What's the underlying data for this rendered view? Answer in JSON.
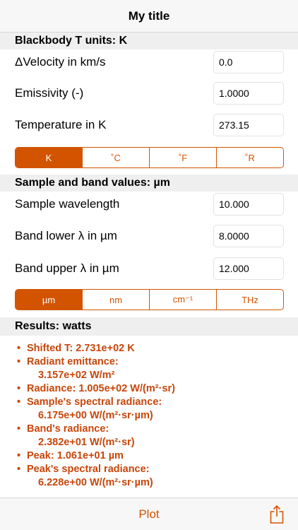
{
  "nav": {
    "title": "My title"
  },
  "sections": {
    "blackbody": "Blackbody T units: K",
    "sample": "Sample and band values: µm",
    "results": "Results: watts"
  },
  "fields": {
    "velocity": {
      "label": "ΔVelocity in km/s",
      "value": "0.0"
    },
    "emissivity": {
      "label": "Emissivity (-)",
      "value": "1.0000"
    },
    "temperature": {
      "label": "Temperature in K",
      "value": "273.15"
    },
    "sample_wavelength": {
      "label": "Sample wavelength",
      "value": "10.000"
    },
    "band_lower": {
      "label": "Band lower λ in µm",
      "value": "8.0000"
    },
    "band_upper": {
      "label": "Band upper λ in µm",
      "value": "12.000"
    }
  },
  "temp_units": {
    "selected": "K",
    "options": [
      "K",
      "˚C",
      "˚F",
      "˚R"
    ]
  },
  "wave_units": {
    "selected": "µm",
    "options": [
      "µm",
      "nm",
      "cm⁻¹",
      "THz"
    ]
  },
  "results": [
    {
      "line1": "Shifted T: 2.731e+02 K",
      "line2": ""
    },
    {
      "line1": "Radiant emittance:",
      "line2": "3.157e+02 W/m²"
    },
    {
      "line1": "Radiance: 1.005e+02 W/(m²·sr)",
      "line2": ""
    },
    {
      "line1": "Sample's spectral radiance:",
      "line2": "6.175e+00 W/(m²·sr·µm)"
    },
    {
      "line1": "Band's radiance:",
      "line2": "2.382e+01 W/(m²·sr)"
    },
    {
      "line1": "Peak: 1.061e+01 µm",
      "line2": ""
    },
    {
      "line1": "Peak's spectral radiance:",
      "line2": "6.228e+00 W/(m²·sr·µm)"
    }
  ],
  "toolbar": {
    "plot_label": "Plot",
    "share_icon": "share-icon"
  },
  "colors": {
    "accent": "#d35400",
    "results_text": "#c8460a",
    "section_bg": "#efefef"
  }
}
